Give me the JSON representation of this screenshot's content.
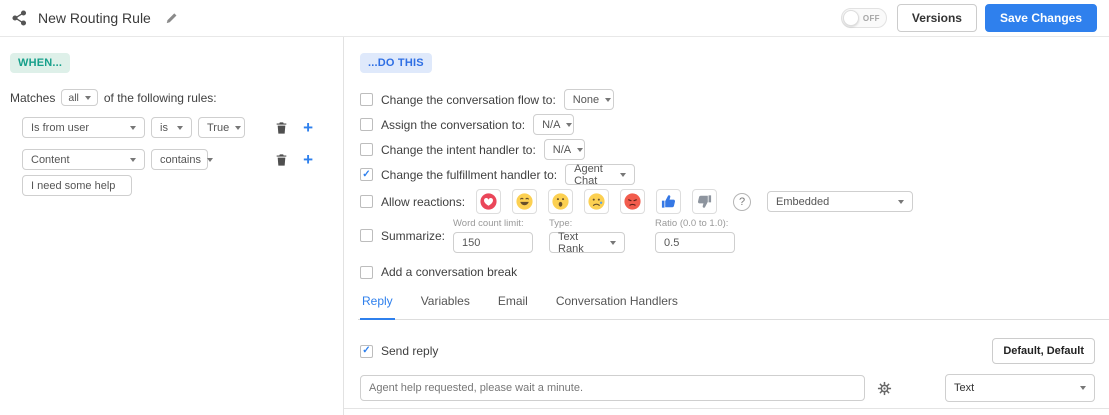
{
  "header": {
    "title": "New Routing Rule",
    "toggle_label": "OFF",
    "versions_label": "Versions",
    "save_label": "Save Changes"
  },
  "when_panel": {
    "badge": "WHEN...",
    "matches_prefix": "Matches",
    "matches_value": "all",
    "matches_suffix": "of the following rules:",
    "rules": [
      {
        "field": "Is from user",
        "operator": "is",
        "value": "True"
      },
      {
        "field": "Content",
        "operator": "contains",
        "value_input": "I need some help"
      }
    ]
  },
  "do_panel": {
    "badge": "...DO THIS",
    "actions": [
      {
        "label": "Change the conversation flow to:",
        "checked": false,
        "value": "None"
      },
      {
        "label": "Assign the conversation to:",
        "checked": false,
        "value": "N/A"
      },
      {
        "label": "Change the intent handler to:",
        "checked": false,
        "value": "N/A"
      },
      {
        "label": "Change the fulfillment handler to:",
        "checked": true,
        "value": "Agent Chat"
      }
    ],
    "reactions": {
      "label": "Allow reactions:",
      "checked": false,
      "items": [
        "love",
        "haha",
        "wow",
        "sad",
        "angry",
        "thumbs-up",
        "thumbs-down"
      ],
      "help_icon": "?",
      "display_mode": "Embedded"
    },
    "summarize": {
      "label": "Summarize:",
      "checked": false,
      "fields": [
        {
          "label": "Word count limit:",
          "value": "150"
        },
        {
          "label": "Type:",
          "value": "Text Rank"
        },
        {
          "label": "Ratio (0.0 to 1.0):",
          "value": "0.5"
        }
      ]
    },
    "conversation_break_label": "Add a conversation break"
  },
  "tabs": {
    "active": "Reply",
    "items": [
      {
        "label": "Reply"
      },
      {
        "label": "Variables"
      },
      {
        "label": "Email"
      },
      {
        "label": "Conversation Handlers"
      }
    ]
  },
  "reply_section": {
    "send_label": "Send reply",
    "send_checked": true,
    "default_button_label": "Default, Default",
    "message_value": "Agent help requested, please wait a minute.",
    "type_value": "Text"
  },
  "colors": {
    "accent_blue": "#2f80ed",
    "badge_green_bg": "#def0e9",
    "badge_green_text": "#17a08b",
    "badge_blue_bg": "#dfe9fb",
    "badge_blue_text": "#2f6fe4"
  }
}
